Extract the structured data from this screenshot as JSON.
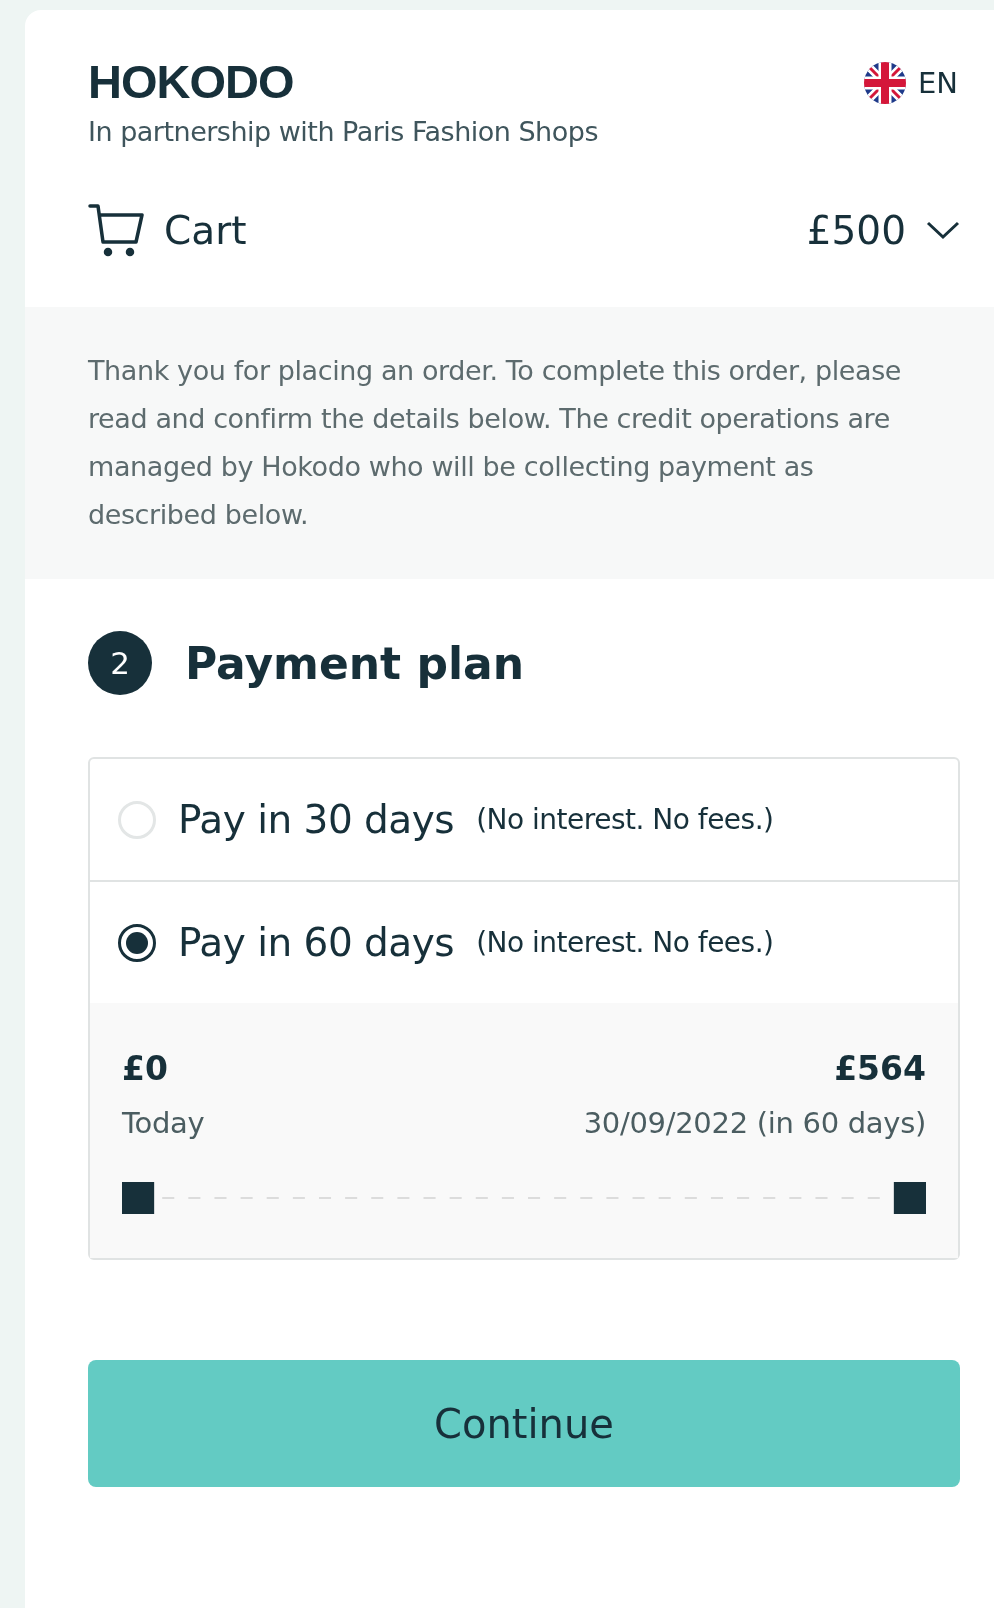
{
  "header": {
    "logo": "HOKODO",
    "subtitle": "In partnership with Paris Fashion Shops",
    "language": "EN"
  },
  "cart": {
    "label": "Cart",
    "amount": "£500",
    "expanded": false
  },
  "intro": "Thank you for placing an order. To complete this order, please read and confirm the details below. The credit operations are managed by Hokodo who will be collecting payment as described below.",
  "step": {
    "number": "2",
    "title": "Payment plan"
  },
  "options": [
    {
      "label": "Pay in 30 days",
      "note": "(No interest. No fees.)",
      "selected": false
    },
    {
      "label": "Pay in 60 days",
      "note": "(No interest. No fees.)",
      "selected": true
    }
  ],
  "schedule": [
    {
      "amount": "£0",
      "date": "Today"
    },
    {
      "amount": "£564",
      "date": "30/09/2022 (in 60 days)"
    }
  ],
  "continue_button": "Continue"
}
